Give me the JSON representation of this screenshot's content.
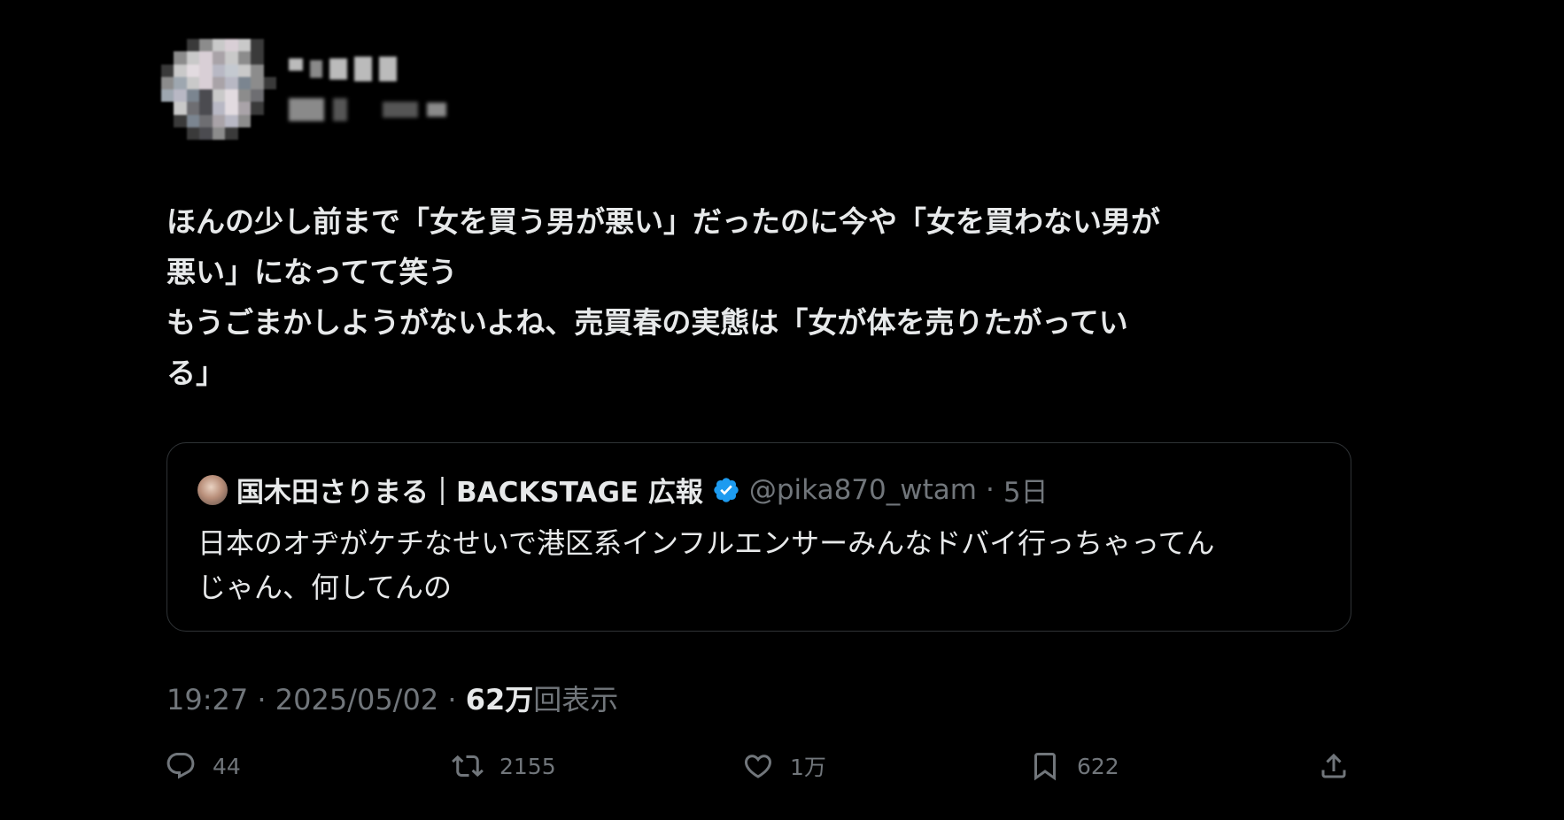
{
  "post": {
    "text": "ほんの少し前まで「女を買う男が悪い」だったのに今や「女を買わない男が\n悪い」になってて笑う\nもうごまかしようがないよね、売買春の実態は「女が体を売りたがってい\nる」"
  },
  "quoted_post": {
    "author_name": "国木田さりまる｜BACKSTAGE 広報",
    "handle": "@pika870_wtam",
    "separator": "·",
    "time": "5日",
    "text": "日本のオヂがケチなせいで港区系インフルエンサーみんなドバイ行っちゃってん\nじゃん、何してんの"
  },
  "meta": {
    "time": "19:27",
    "dot1": " · ",
    "date": "2025/05/02",
    "dot2": " · ",
    "views_count": "62万",
    "views_label": "回表示"
  },
  "actions": {
    "replies": "44",
    "reposts": "2155",
    "likes": "1万",
    "bookmarks": "622"
  },
  "icons": {
    "reply": "reply-icon",
    "repost": "repost-icon",
    "like": "heart-icon",
    "bookmark": "bookmark-icon",
    "share": "share-icon",
    "verified": "verified-badge-icon"
  },
  "colors": {
    "background": "#000000",
    "text": "#e7e9ea",
    "secondary": "#71767b",
    "verified": "#1d9bf0",
    "border": "#2f3336"
  }
}
